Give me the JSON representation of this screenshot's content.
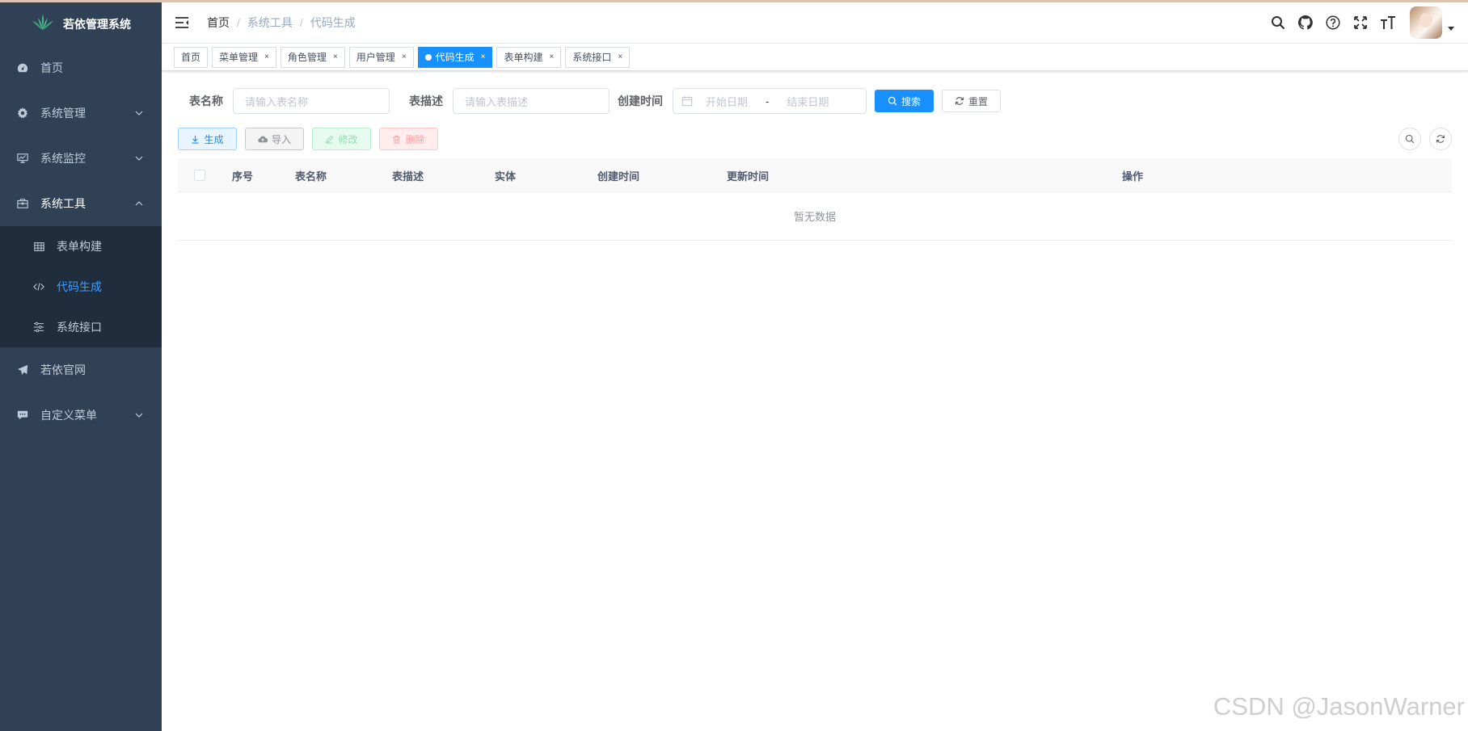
{
  "app": {
    "title": "若依管理系统"
  },
  "sidebar": {
    "items": [
      {
        "label": "首页",
        "icon": "dashboard-icon"
      },
      {
        "label": "系统管理",
        "icon": "gear-icon",
        "expandable": true
      },
      {
        "label": "系统监控",
        "icon": "monitor-icon",
        "expandable": true
      },
      {
        "label": "系统工具",
        "icon": "toolbox-icon",
        "expandable": true,
        "open": true,
        "children": [
          {
            "label": "表单构建",
            "icon": "table-grid-icon"
          },
          {
            "label": "代码生成",
            "icon": "code-icon",
            "active": true
          },
          {
            "label": "系统接口",
            "icon": "sliders-icon"
          }
        ]
      },
      {
        "label": "若依官网",
        "icon": "send-icon"
      },
      {
        "label": "自定义菜单",
        "icon": "chat-icon",
        "expandable": true
      }
    ]
  },
  "navbar": {
    "breadcrumb": [
      "首页",
      "系统工具",
      "代码生成"
    ]
  },
  "tags": [
    {
      "label": "首页",
      "closable": false
    },
    {
      "label": "菜单管理",
      "closable": true
    },
    {
      "label": "角色管理",
      "closable": true
    },
    {
      "label": "用户管理",
      "closable": true
    },
    {
      "label": "代码生成",
      "closable": true,
      "active": true
    },
    {
      "label": "表单构建",
      "closable": true
    },
    {
      "label": "系统接口",
      "closable": true
    }
  ],
  "close_glyph": "×",
  "search_form": {
    "table_name_label": "表名称",
    "table_name_placeholder": "请输入表名称",
    "table_desc_label": "表描述",
    "table_desc_placeholder": "请输入表描述",
    "create_time_label": "创建时间",
    "start_date_placeholder": "开始日期",
    "range_separator": "-",
    "end_date_placeholder": "结束日期",
    "search_label": "搜索",
    "reset_label": "重置"
  },
  "toolbar": {
    "generate_label": "生成",
    "import_label": "导入",
    "edit_label": "修改",
    "delete_label": "删除"
  },
  "table": {
    "columns": [
      "序号",
      "表名称",
      "表描述",
      "实体",
      "创建时间",
      "更新时间",
      "操作"
    ],
    "empty_text": "暂无数据"
  },
  "watermark": "CSDN @JasonWarner",
  "colors": {
    "sidebar_bg": "#304156",
    "submenu_bg": "#1f2d3d",
    "primary": "#1890ff",
    "active_text": "#409eff"
  }
}
